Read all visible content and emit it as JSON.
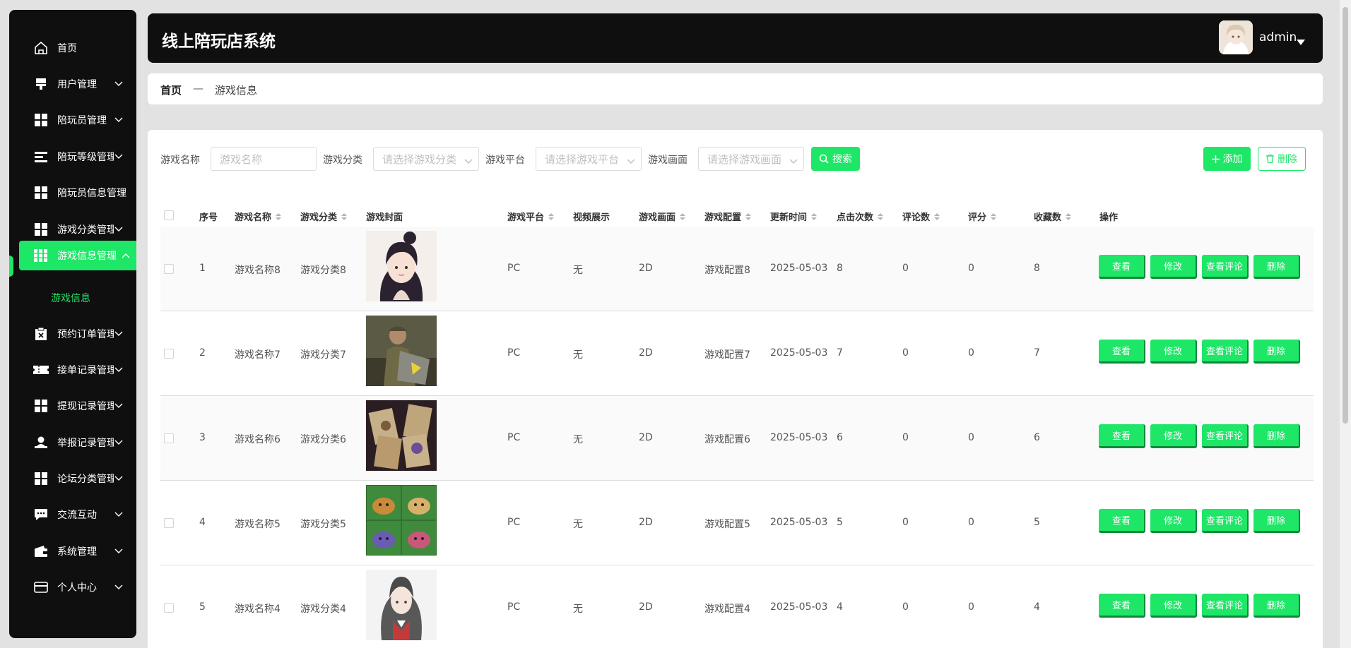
{
  "sidebar": {
    "items": [
      {
        "label": "首页",
        "icon": "home-icon",
        "chevron": false
      },
      {
        "label": "用户管理",
        "icon": "user-manage-icon",
        "chevron": true
      },
      {
        "label": "陪玩员管理",
        "icon": "grid-icon",
        "chevron": true
      },
      {
        "label": "陪玩等级管理",
        "icon": "list-icon",
        "chevron": true
      },
      {
        "label": "陪玩员信息管理",
        "icon": "grid-icon",
        "chevron": false
      },
      {
        "label": "游戏分类管理",
        "icon": "grid-icon",
        "chevron": true
      },
      {
        "label": "游戏信息管理",
        "icon": "grid-icon",
        "chevron": true,
        "active": true
      },
      {
        "label": "预约订单管理",
        "icon": "clipboard-x-icon",
        "chevron": true
      },
      {
        "label": "接单记录管理",
        "icon": "ticket-icon",
        "chevron": true
      },
      {
        "label": "提现记录管理",
        "icon": "grid-icon",
        "chevron": true
      },
      {
        "label": "举报记录管理",
        "icon": "person-stand-icon",
        "chevron": true
      },
      {
        "label": "论坛分类管理",
        "icon": "grid-icon",
        "chevron": true
      },
      {
        "label": "交流互动",
        "icon": "chat-icon",
        "chevron": true
      },
      {
        "label": "系统管理",
        "icon": "wallet-icon",
        "chevron": true
      },
      {
        "label": "个人中心",
        "icon": "card-icon",
        "chevron": true
      }
    ],
    "sub_active": "游戏信息"
  },
  "header": {
    "title": "线上陪玩店系统",
    "username": "admin"
  },
  "breadcrumb": {
    "home": "首页",
    "separator": "—",
    "current": "游戏信息"
  },
  "filters": {
    "name_label": "游戏名称",
    "name_placeholder": "游戏名称",
    "category_label": "游戏分类",
    "category_placeholder": "请选择游戏分类",
    "platform_label": "游戏平台",
    "platform_placeholder": "请选择游戏平台",
    "graphics_label": "游戏画面",
    "graphics_placeholder": "请选择游戏画面",
    "search_button": "搜索",
    "add_button": "添加",
    "delete_button": "删除"
  },
  "table": {
    "columns": [
      "序号",
      "游戏名称",
      "游戏分类",
      "游戏封面",
      "游戏平台",
      "视频展示",
      "游戏画面",
      "游戏配置",
      "更新时间",
      "点击次数",
      "评论数",
      "评分",
      "收藏数",
      "操作"
    ],
    "rows": [
      {
        "index": "1",
        "name": "游戏名称8",
        "category": "游戏分类8",
        "platform": "PC",
        "video": "无",
        "graphics": "2D",
        "config": "游戏配置8",
        "updated": "2025-05-03",
        "clicks": "8",
        "comments": "0",
        "rating": "0",
        "favorites": "8"
      },
      {
        "index": "2",
        "name": "游戏名称7",
        "category": "游戏分类7",
        "platform": "PC",
        "video": "无",
        "graphics": "2D",
        "config": "游戏配置7",
        "updated": "2025-05-03",
        "clicks": "7",
        "comments": "0",
        "rating": "0",
        "favorites": "7"
      },
      {
        "index": "3",
        "name": "游戏名称6",
        "category": "游戏分类6",
        "platform": "PC",
        "video": "无",
        "graphics": "2D",
        "config": "游戏配置6",
        "updated": "2025-05-03",
        "clicks": "6",
        "comments": "0",
        "rating": "0",
        "favorites": "6"
      },
      {
        "index": "4",
        "name": "游戏名称5",
        "category": "游戏分类5",
        "platform": "PC",
        "video": "无",
        "graphics": "2D",
        "config": "游戏配置5",
        "updated": "2025-05-03",
        "clicks": "5",
        "comments": "0",
        "rating": "0",
        "favorites": "5"
      },
      {
        "index": "5",
        "name": "游戏名称4",
        "category": "游戏分类4",
        "platform": "PC",
        "video": "无",
        "graphics": "2D",
        "config": "游戏配置4",
        "updated": "2025-05-03",
        "clicks": "4",
        "comments": "0",
        "rating": "0",
        "favorites": "4"
      }
    ],
    "actions": {
      "view": "查看",
      "edit": "修改",
      "view_comments": "查看评论",
      "delete": "删除"
    }
  },
  "colors": {
    "accent": "#1ee667",
    "dark": "#0f0f0f"
  }
}
